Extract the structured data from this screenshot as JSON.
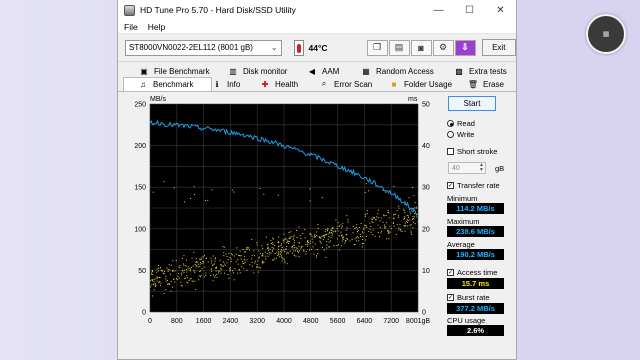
{
  "window": {
    "title": "HD Tune Pro 5.70 - Hard Disk/SSD Utility",
    "controls": {
      "minimize": "—",
      "maximize": "☐",
      "close": "✕"
    }
  },
  "menu": [
    "File",
    "Help"
  ],
  "toolbar": {
    "drive": "ST8000VN0022-2EL112 (8001 gB)",
    "temperature": "44°C",
    "exit_label": "Exit",
    "tool_icons": [
      "copy-icon",
      "copy-text-icon",
      "screenshot-icon",
      "options-icon",
      "save-icon"
    ]
  },
  "tabs": {
    "row1": [
      "File Benchmark",
      "Disk monitor",
      "AAM",
      "Random Access",
      "Extra tests"
    ],
    "row2": [
      "Benchmark",
      "Info",
      "Health",
      "Error Scan",
      "Folder Usage",
      "Erase"
    ]
  },
  "side": {
    "start_label": "Start",
    "read_label": "Read",
    "write_label": "Write",
    "short_stroke_label": "Short stroke",
    "short_stroke_value": "40",
    "gb_label": "gB",
    "transfer_rate_label": "Transfer rate",
    "minimum_label": "Minimum",
    "minimum_value": "114.2 MB/s",
    "maximum_label": "Maximum",
    "maximum_value": "238.6 MB/s",
    "average_label": "Average",
    "average_value": "190.2 MB/s",
    "access_time_label": "Access time",
    "access_time_value": "15.7 ms",
    "burst_rate_label": "Burst rate",
    "burst_rate_value": "377.2 MB/s",
    "cpu_usage_label": "CPU usage",
    "cpu_usage_value": "2.6%"
  },
  "colors": {
    "transfer_line": "#1a9fe6",
    "access_points": "#e6d84a",
    "plot_background": "#000000",
    "grid": "#3a3a3a"
  },
  "chart_data": {
    "type": "line",
    "left_axis_unit": "MB/s",
    "right_axis_unit": "ms",
    "x_ticks": [
      "0",
      "800",
      "1600",
      "2400",
      "3200",
      "4000",
      "4800",
      "5600",
      "6400",
      "7200",
      "8001gB"
    ],
    "y_ticks_left": [
      "0",
      "50",
      "100",
      "150",
      "200",
      "250"
    ],
    "y_ticks_right": [
      "0",
      "10",
      "20",
      "30",
      "40",
      "50"
    ],
    "xlim": [
      0,
      8001
    ],
    "ylim_left": [
      0,
      250
    ],
    "ylim_right": [
      0,
      50
    ],
    "grid": true,
    "series": [
      {
        "kind": "transfer",
        "x": [
          0,
          300,
          600,
          900,
          1200,
          1500,
          1800,
          2100,
          2400,
          2700,
          3000,
          3300,
          3600,
          3900,
          4200,
          4500,
          4800,
          5100,
          5400,
          5700,
          6000,
          6300,
          6600,
          6900,
          7200,
          7500,
          7800,
          8001
        ],
        "y": [
          228,
          227,
          225,
          224,
          223,
          221,
          220,
          218,
          216,
          214,
          211,
          208,
          205,
          201,
          197,
          193,
          189,
          184,
          179,
          174,
          169,
          163,
          157,
          150,
          143,
          135,
          124,
          117
        ]
      },
      {
        "kind": "access_time_points",
        "band_x": [
          0,
          1000,
          2000,
          3000,
          4000,
          5000,
          6000,
          7000,
          8001
        ],
        "band_low_ms": [
          3,
          4.5,
          6,
          8,
          10,
          12,
          14,
          16,
          18
        ],
        "band_high_ms": [
          13,
          15,
          17,
          19,
          21,
          23,
          25,
          27,
          29
        ],
        "outliers_ms": [
          30,
          28
        ]
      }
    ]
  }
}
